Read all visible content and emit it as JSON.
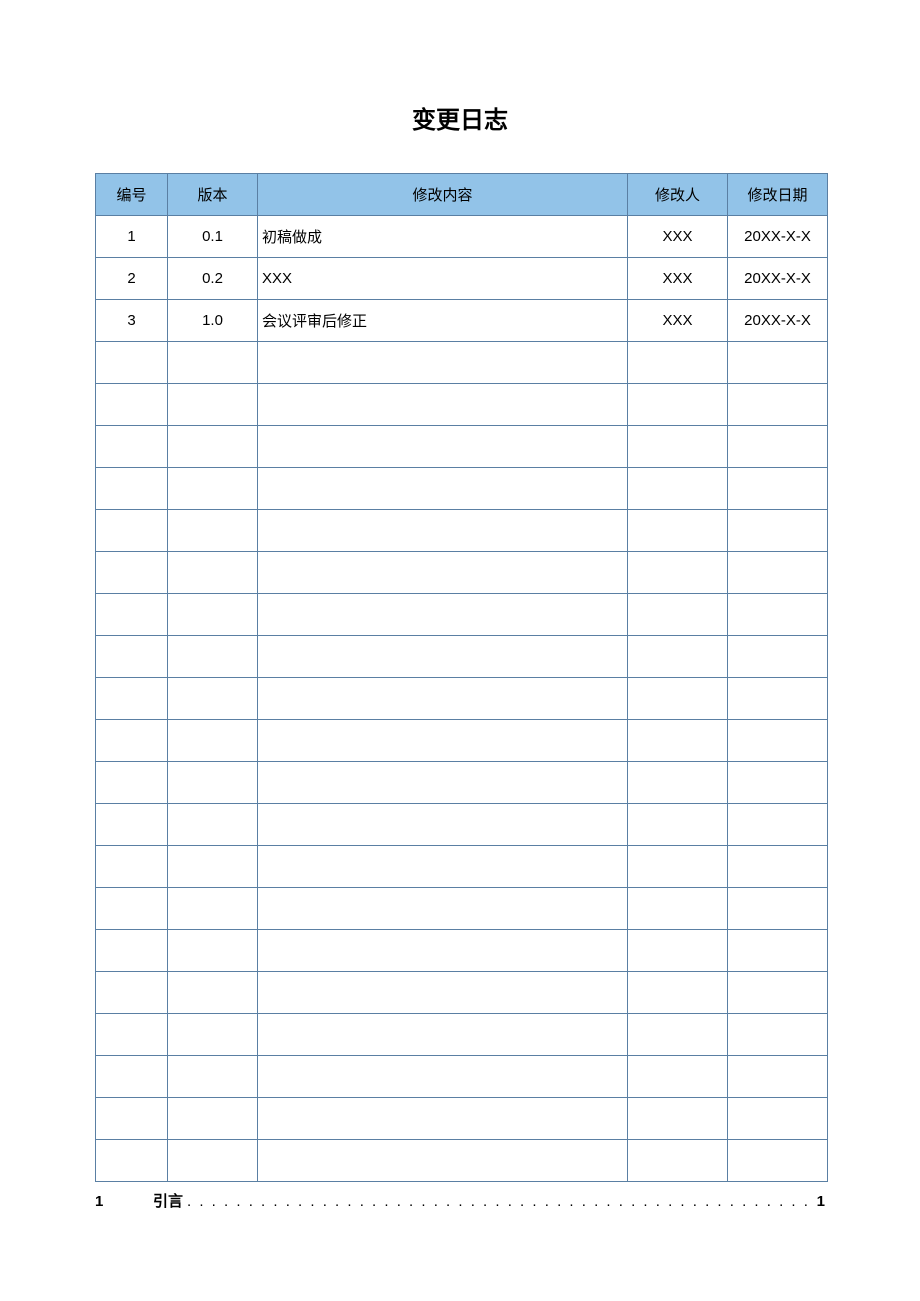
{
  "title": "变更日志",
  "table": {
    "headers": {
      "num": "编号",
      "version": "版本",
      "content": "修改内容",
      "author": "修改人",
      "date": "修改日期"
    },
    "rows": [
      {
        "num": "1",
        "version": "0.1",
        "content": "初稿做成",
        "author": "XXX",
        "date": "20XX-X-X"
      },
      {
        "num": "2",
        "version": "0.2",
        "content": "XXX",
        "author": "XXX",
        "date": "20XX-X-X"
      },
      {
        "num": "3",
        "version": "1.0",
        "content": "会议评审后修正",
        "author": "XXX",
        "date": "20XX-X-X"
      },
      {
        "num": "",
        "version": "",
        "content": "",
        "author": "",
        "date": ""
      },
      {
        "num": "",
        "version": "",
        "content": "",
        "author": "",
        "date": ""
      },
      {
        "num": "",
        "version": "",
        "content": "",
        "author": "",
        "date": ""
      },
      {
        "num": "",
        "version": "",
        "content": "",
        "author": "",
        "date": ""
      },
      {
        "num": "",
        "version": "",
        "content": "",
        "author": "",
        "date": ""
      },
      {
        "num": "",
        "version": "",
        "content": "",
        "author": "",
        "date": ""
      },
      {
        "num": "",
        "version": "",
        "content": "",
        "author": "",
        "date": ""
      },
      {
        "num": "",
        "version": "",
        "content": "",
        "author": "",
        "date": ""
      },
      {
        "num": "",
        "version": "",
        "content": "",
        "author": "",
        "date": ""
      },
      {
        "num": "",
        "version": "",
        "content": "",
        "author": "",
        "date": ""
      },
      {
        "num": "",
        "version": "",
        "content": "",
        "author": "",
        "date": ""
      },
      {
        "num": "",
        "version": "",
        "content": "",
        "author": "",
        "date": ""
      },
      {
        "num": "",
        "version": "",
        "content": "",
        "author": "",
        "date": ""
      },
      {
        "num": "",
        "version": "",
        "content": "",
        "author": "",
        "date": ""
      },
      {
        "num": "",
        "version": "",
        "content": "",
        "author": "",
        "date": ""
      },
      {
        "num": "",
        "version": "",
        "content": "",
        "author": "",
        "date": ""
      },
      {
        "num": "",
        "version": "",
        "content": "",
        "author": "",
        "date": ""
      },
      {
        "num": "",
        "version": "",
        "content": "",
        "author": "",
        "date": ""
      },
      {
        "num": "",
        "version": "",
        "content": "",
        "author": "",
        "date": ""
      },
      {
        "num": "",
        "version": "",
        "content": "",
        "author": "",
        "date": ""
      }
    ]
  },
  "toc": {
    "num": "1",
    "text": "引言",
    "page": "1"
  }
}
